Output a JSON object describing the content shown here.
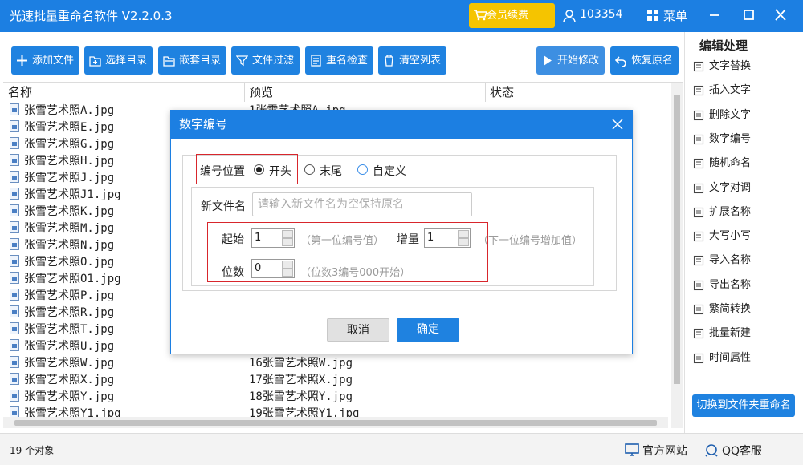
{
  "app": {
    "title": "光速批量重命名软件 V2.2.0.3"
  },
  "header": {
    "vip_label": "会员续费",
    "user_id": "103354",
    "menu_label": "菜单"
  },
  "toolbar": {
    "add_file": "添加文件",
    "choose_dir": "选择目录",
    "nested_dir": "嵌套目录",
    "file_filter": "文件过滤",
    "rename_check": "重名检查",
    "clear_list": "清空列表",
    "start": "开始修改",
    "restore": "恢复原名"
  },
  "list": {
    "columns": [
      "名称",
      "预览",
      "状态"
    ],
    "rows": [
      {
        "name": "张雪艺术照A.jpg",
        "preview": "1张雪艺术照A.jpg"
      },
      {
        "name": "张雪艺术照E.jpg",
        "preview": ""
      },
      {
        "name": "张雪艺术照G.jpg",
        "preview": ""
      },
      {
        "name": "张雪艺术照H.jpg",
        "preview": ""
      },
      {
        "name": "张雪艺术照J.jpg",
        "preview": ""
      },
      {
        "name": "张雪艺术照J1.jpg",
        "preview": ""
      },
      {
        "name": "张雪艺术照K.jpg",
        "preview": ""
      },
      {
        "name": "张雪艺术照M.jpg",
        "preview": ""
      },
      {
        "name": "张雪艺术照N.jpg",
        "preview": ""
      },
      {
        "name": "张雪艺术照O.jpg",
        "preview": ""
      },
      {
        "name": "张雪艺术照O1.jpg",
        "preview": ""
      },
      {
        "name": "张雪艺术照P.jpg",
        "preview": ""
      },
      {
        "name": "张雪艺术照R.jpg",
        "preview": ""
      },
      {
        "name": "张雪艺术照T.jpg",
        "preview": ""
      },
      {
        "name": "张雪艺术照U.jpg",
        "preview": ""
      },
      {
        "name": "张雪艺术照W.jpg",
        "preview": "16张雪艺术照W.jpg"
      },
      {
        "name": "张雪艺术照X.jpg",
        "preview": "17张雪艺术照X.jpg"
      },
      {
        "name": "张雪艺术照Y.jpg",
        "preview": "18张雪艺术照Y.jpg"
      },
      {
        "name": "张雪艺术照Y1.jpg",
        "preview": "19张雪艺术照Y1.jpg"
      }
    ]
  },
  "status": {
    "count": "19 个对象",
    "website": "官方网站",
    "qq": "QQ客服"
  },
  "sidebar": {
    "title": "编辑处理",
    "items": [
      "文字替换",
      "插入文字",
      "删除文字",
      "数字编号",
      "随机命名",
      "文字对调",
      "扩展名称",
      "大写小写",
      "导入名称",
      "导出名称",
      "繁简转换",
      "批量新建",
      "时间属性"
    ],
    "switch_button": "切换到文件夹重命名"
  },
  "dialog": {
    "title": "数字编号",
    "position_label": "编号位置",
    "position_options": [
      "开头",
      "末尾",
      "自定义"
    ],
    "selected_position": "开头",
    "new_name_label": "新文件名",
    "new_name_placeholder": "请输入新文件名为空保持原名",
    "start_label": "起始",
    "start_value": "1",
    "start_hint": "（第一位编号值）",
    "step_label": "增量",
    "step_value": "1",
    "step_hint": "（下一位编号增加值）",
    "digits_label": "位数",
    "digits_value": "0",
    "digits_hint": "（位数3编号000开始）",
    "cancel": "取消",
    "ok": "确定"
  },
  "colors": {
    "primary": "#1f82e0",
    "titlebar": "#1c7fe2",
    "vip": "#f5c400",
    "highlight_box": "#d8262c"
  }
}
